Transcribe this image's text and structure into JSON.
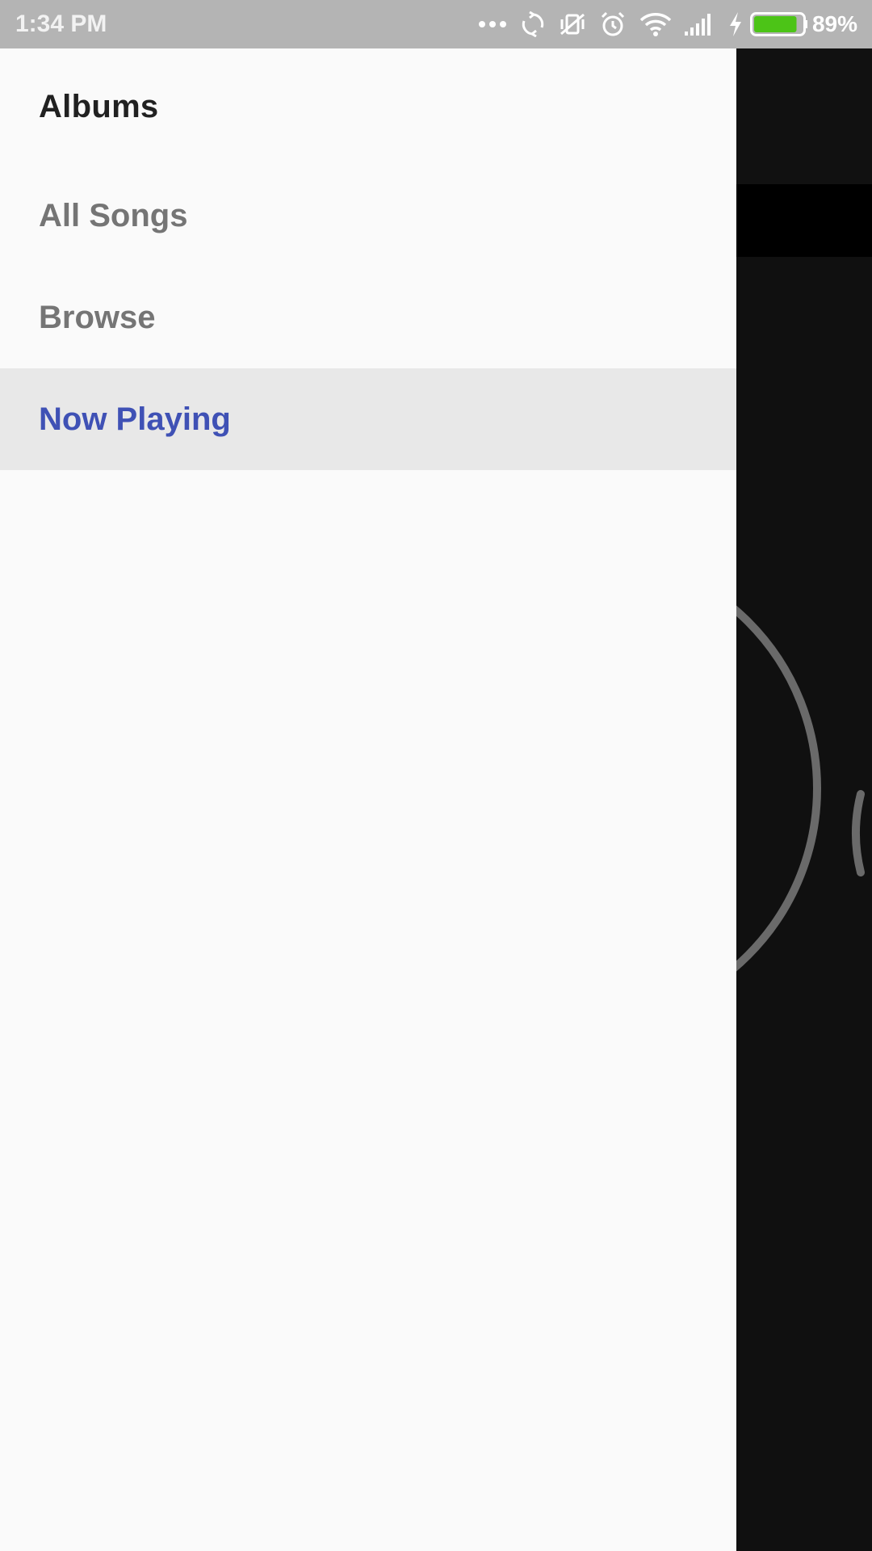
{
  "status_bar": {
    "time": "1:34 PM",
    "battery_percent": "89%",
    "battery_level": 0.89,
    "battery_color": "#4cc417",
    "icons": [
      "more-dots-icon",
      "sync-icon",
      "vibrate-off-icon",
      "alarm-icon",
      "wifi-icon",
      "signal-icon",
      "charging-bolt-icon",
      "battery-icon"
    ]
  },
  "drawer": {
    "header": "Albums",
    "items": [
      {
        "label": "All Songs",
        "active": false
      },
      {
        "label": "Browse",
        "active": false
      },
      {
        "label": "Now Playing",
        "active": true
      }
    ],
    "accent_color": "#3f51b5"
  }
}
